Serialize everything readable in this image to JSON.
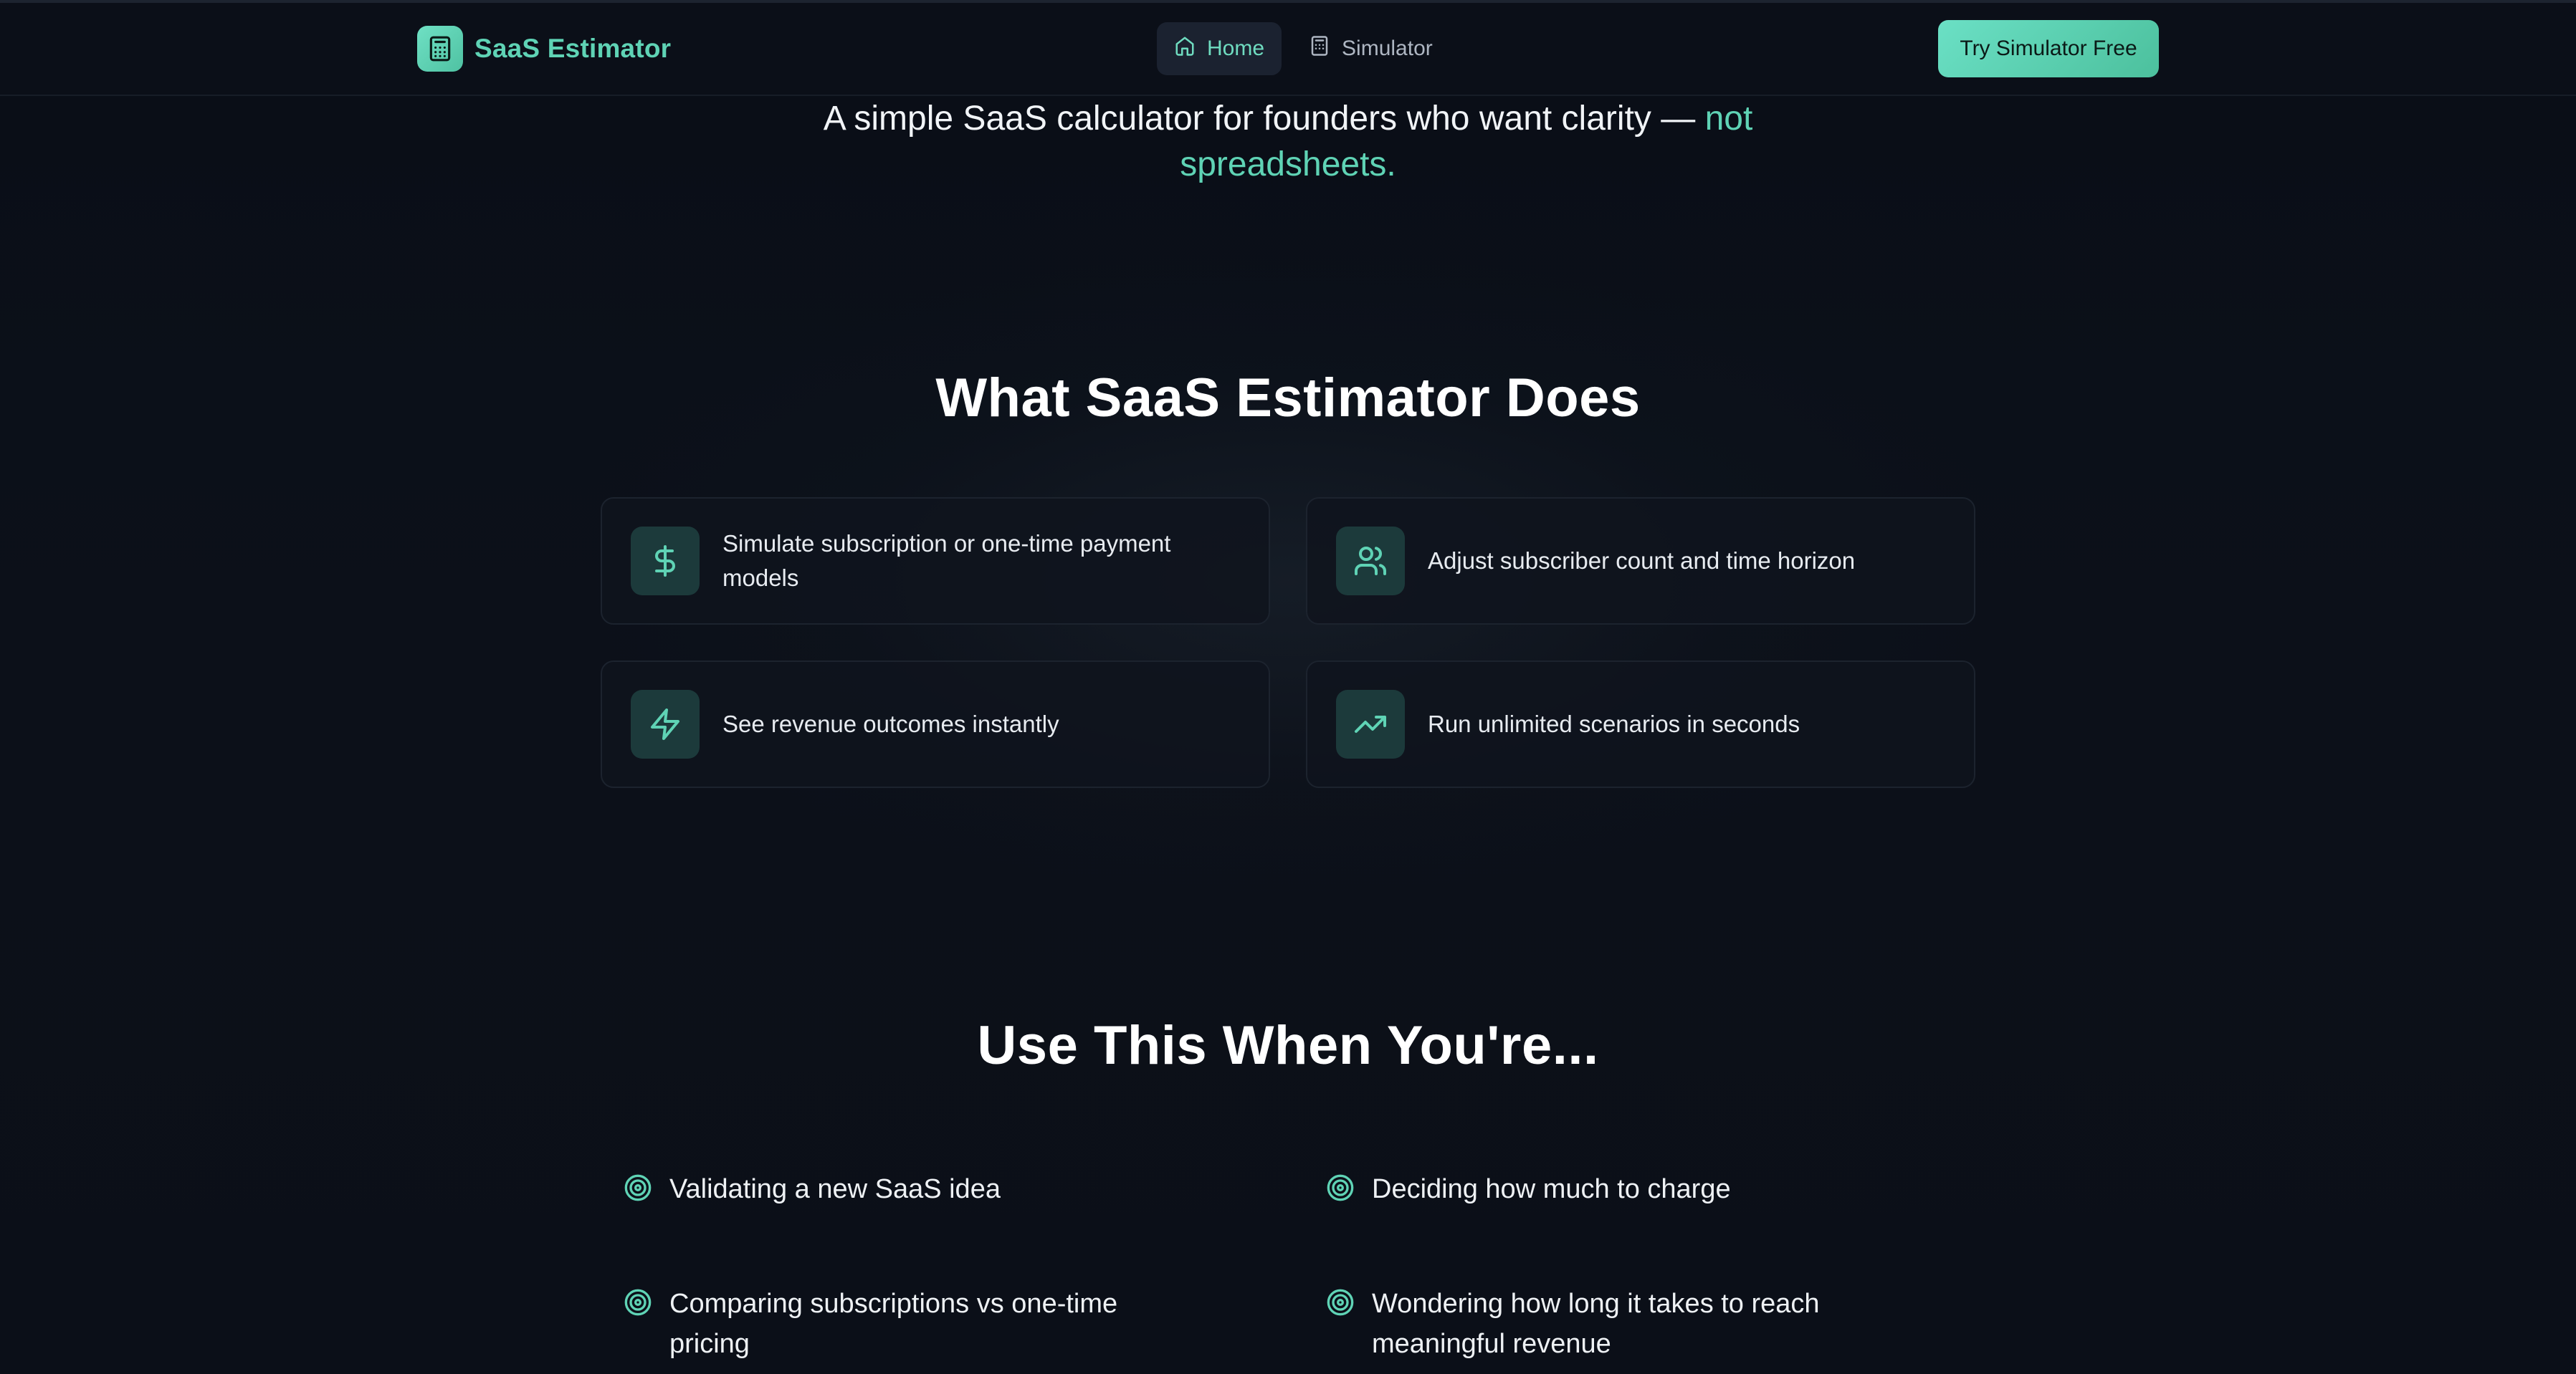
{
  "nav": {
    "brand": "SaaS Estimator",
    "links": [
      {
        "label": "Home",
        "icon": "home-icon",
        "active": true
      },
      {
        "label": "Simulator",
        "icon": "calculator-icon",
        "active": false
      }
    ],
    "cta": "Try Simulator Free"
  },
  "hero": {
    "tagline_main": "A simple SaaS calculator for founders who want clarity —",
    "tagline_accent_1": "not",
    "tagline_accent_2": "spreadsheets."
  },
  "features": {
    "title": "What SaaS Estimator Does",
    "items": [
      {
        "icon": "dollar-icon",
        "text": "Simulate subscription or one-time payment models"
      },
      {
        "icon": "users-icon",
        "text": "Adjust subscriber count and time horizon"
      },
      {
        "icon": "lightning-icon",
        "text": "See revenue outcomes instantly"
      },
      {
        "icon": "trending-up-icon",
        "text": "Run unlimited scenarios in seconds"
      }
    ]
  },
  "use_cases": {
    "title": "Use This When You're...",
    "items": [
      {
        "icon": "target-icon",
        "text": "Validating a new SaaS idea"
      },
      {
        "icon": "target-icon",
        "text": "Deciding how much to charge"
      },
      {
        "icon": "target-icon",
        "text": "Comparing subscriptions vs one-time pricing"
      },
      {
        "icon": "target-icon",
        "text": "Wondering how long it takes to reach meaningful revenue"
      }
    ]
  },
  "colors": {
    "background": "#0a0e16",
    "accent": "#5fd3b5",
    "card_border": "#1c232e",
    "icon_tile": "#1c3a3b"
  }
}
